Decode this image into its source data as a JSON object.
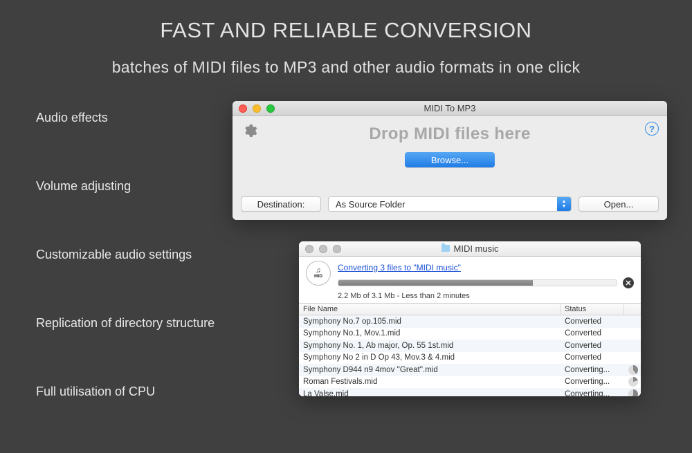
{
  "hero": {
    "title": "FAST AND RELIABLE CONVERSION",
    "subtitle": "batches of MIDI files to MP3 and other audio formats in one click"
  },
  "features": [
    "Audio effects",
    "Volume adjusting",
    "Customizable audio settings",
    "Replication of directory structure",
    "Full utilisation of CPU"
  ],
  "main_window": {
    "title": "MIDI To MP3",
    "drop_label": "Drop MIDI files here",
    "browse": "Browse...",
    "destination_label": "Destination:",
    "destination_value": "As Source Folder",
    "open": "Open...",
    "help": "?"
  },
  "progress_window": {
    "title": "MIDI music",
    "link": "Converting 3 files to \"MIDI music\"",
    "status_line": "2.2 Mb of 3.1 Mb - Less than 2 minutes",
    "badge_top": "♫",
    "badge_bottom": "MID",
    "headers": {
      "file": "File Name",
      "status": "Status"
    },
    "rows": [
      {
        "name": "Symphony No.7 op.105.mid",
        "status": "Converted",
        "spin": ""
      },
      {
        "name": "Symphony No.1, Mov.1.mid",
        "status": "Converted",
        "spin": ""
      },
      {
        "name": "Symphony No. 1, Ab major, Op. 55 1st.mid",
        "status": "Converted",
        "spin": ""
      },
      {
        "name": "Symphony No 2 in D Op 43, Mov.3 & 4.mid",
        "status": "Converted",
        "spin": ""
      },
      {
        "name": "Symphony D944 n9 4mov ''Great''.mid",
        "status": "Converting...",
        "spin": "s1"
      },
      {
        "name": "Roman Festivals.mid",
        "status": "Converting...",
        "spin": "s2"
      },
      {
        "name": "La Valse.mid",
        "status": "Converting...",
        "spin": "s3"
      }
    ]
  }
}
